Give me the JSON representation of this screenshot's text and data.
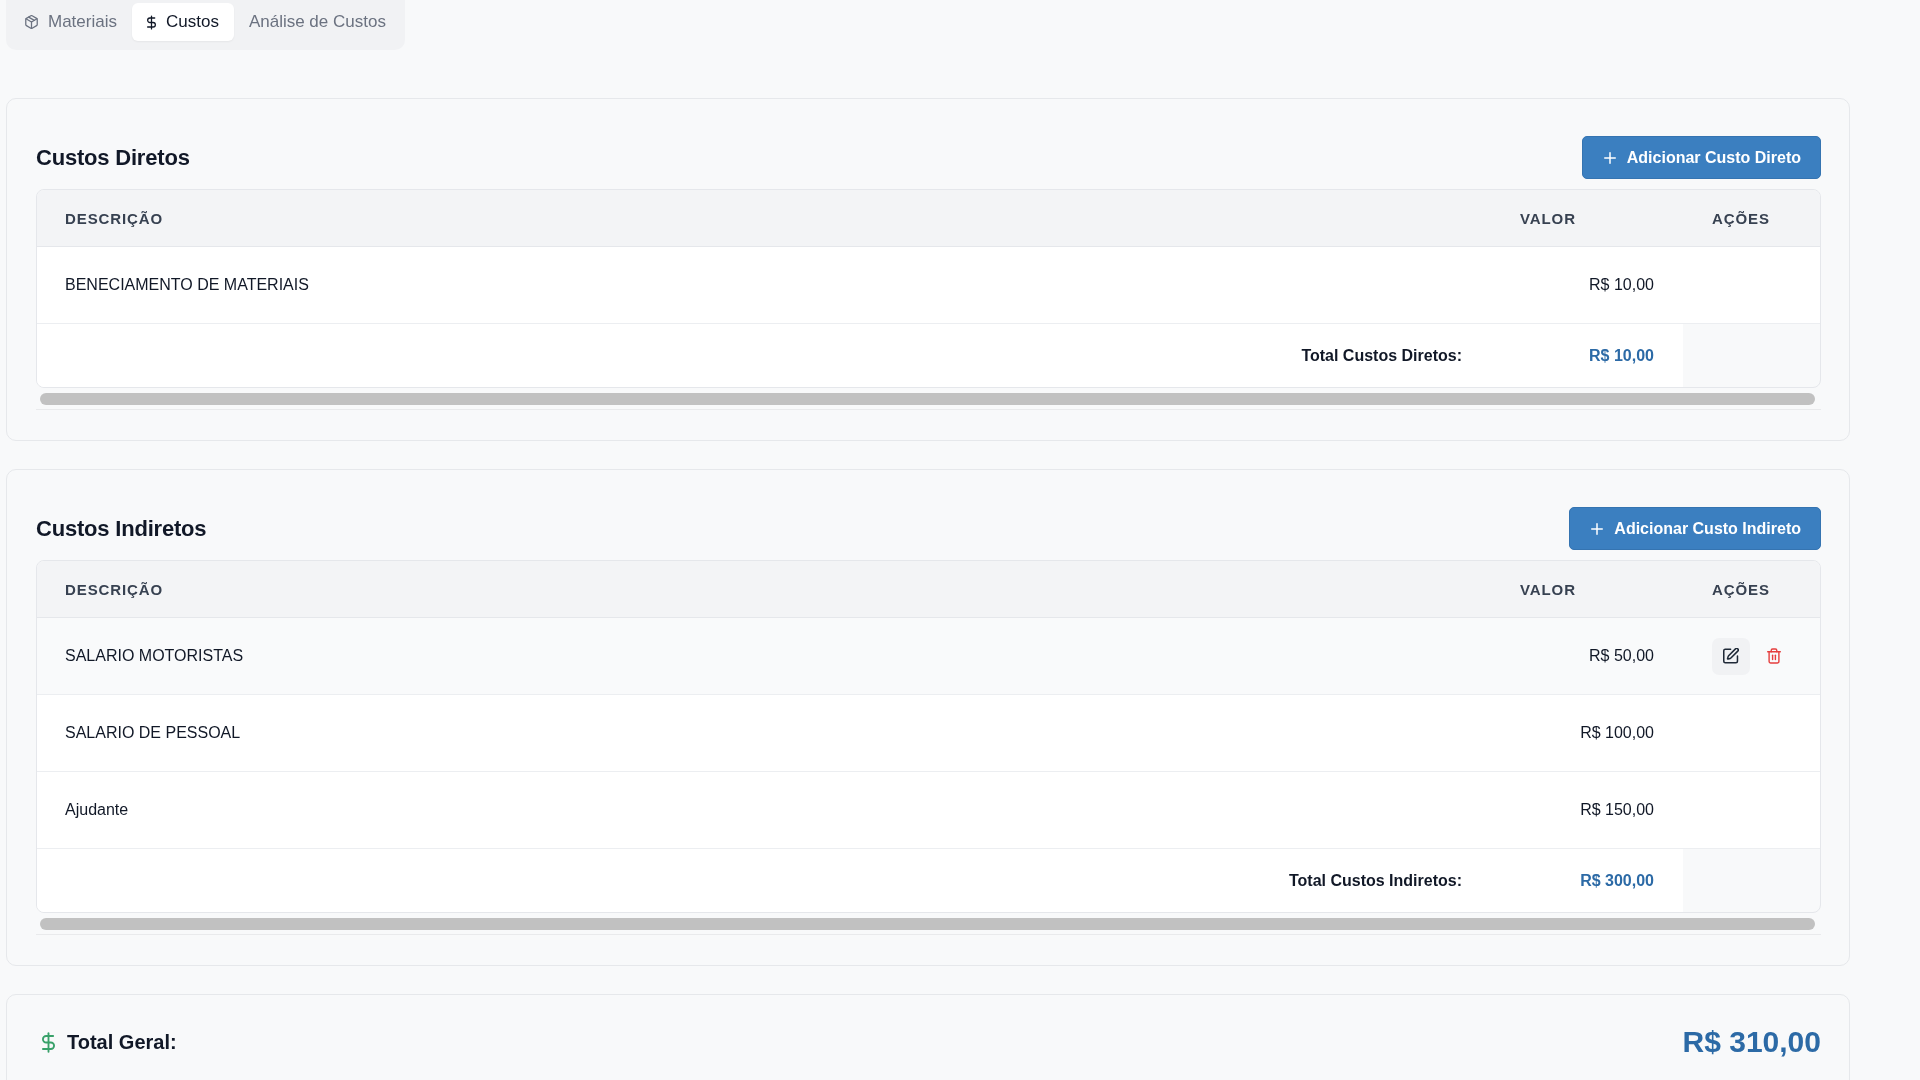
{
  "tabs": [
    {
      "label": "Materiais",
      "kind": "materials",
      "selected": false
    },
    {
      "label": "Custos",
      "kind": "costs",
      "selected": true
    },
    {
      "label": "Análise de Custos",
      "kind": "analysis",
      "selected": false
    }
  ],
  "sections": [
    {
      "title": "Custos Diretos",
      "add_button": "Adicionar Custo Direto",
      "columns": [
        "DESCRIÇÃO",
        "VALOR",
        "AÇÕES"
      ],
      "rows": [
        {
          "description": "BENECIAMENTO DE MATERIAIS",
          "value": "R$ 10,00",
          "hovered": false
        }
      ],
      "total": {
        "label": "Total Custos Diretos:",
        "value": "R$ 10,00"
      }
    },
    {
      "title": "Custos Indiretos",
      "add_button": "Adicionar Custo Indireto",
      "columns": [
        "DESCRIÇÃO",
        "VALOR",
        "AÇÕES"
      ],
      "rows": [
        {
          "description": "SALARIO MOTORISTAS",
          "value": "R$ 50,00",
          "hovered": true
        },
        {
          "description": "SALARIO DE PESSOAL",
          "value": "R$ 100,00",
          "hovered": false
        },
        {
          "description": "Ajudante",
          "value": "R$ 150,00",
          "hovered": false
        }
      ],
      "total": {
        "label": "Total Custos Indiretos:",
        "value": "R$ 300,00"
      }
    }
  ],
  "grand_total": {
    "label": "Total Geral:",
    "value": "R$ 310,00"
  }
}
